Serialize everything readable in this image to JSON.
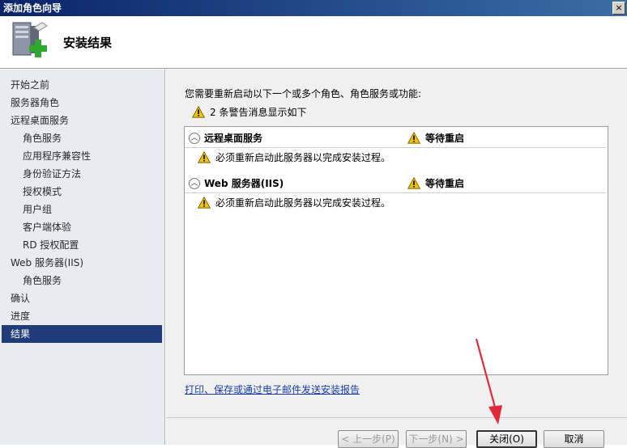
{
  "window": {
    "title": "添加角色向导",
    "close_glyph": "×"
  },
  "header": {
    "title": "安装结果"
  },
  "nav": {
    "items": [
      {
        "label": "开始之前",
        "sub": false,
        "active": false
      },
      {
        "label": "服务器角色",
        "sub": false,
        "active": false
      },
      {
        "label": "远程桌面服务",
        "sub": false,
        "active": false
      },
      {
        "label": "角色服务",
        "sub": true,
        "active": false
      },
      {
        "label": "应用程序兼容性",
        "sub": true,
        "active": false
      },
      {
        "label": "身份验证方法",
        "sub": true,
        "active": false
      },
      {
        "label": "授权模式",
        "sub": true,
        "active": false
      },
      {
        "label": "用户组",
        "sub": true,
        "active": false
      },
      {
        "label": "客户端体验",
        "sub": true,
        "active": false
      },
      {
        "label": "RD 授权配置",
        "sub": true,
        "active": false
      },
      {
        "label": "Web 服务器(IIS)",
        "sub": false,
        "active": false
      },
      {
        "label": "角色服务",
        "sub": true,
        "active": false
      },
      {
        "label": "确认",
        "sub": false,
        "active": false
      },
      {
        "label": "进度",
        "sub": false,
        "active": false
      },
      {
        "label": "结果",
        "sub": false,
        "active": true
      }
    ]
  },
  "main": {
    "intro": "您需要重新启动以下一个或多个角色、角色服务或功能:",
    "warning_summary": "2 条警告消息显示如下",
    "results": [
      {
        "name": "远程桌面服务",
        "status": "等待重启",
        "message": "必须重新启动此服务器以完成安装过程。"
      },
      {
        "name": "Web 服务器(IIS)",
        "status": "等待重启",
        "message": "必须重新启动此服务器以完成安装过程。"
      }
    ],
    "report_link": "打印、保存或通过电子邮件发送安装报告"
  },
  "buttons": {
    "back": "< 上一步(P)",
    "next": "下一步(N) >",
    "close": "关闭(O)",
    "cancel": "取消"
  },
  "colors": {
    "nav_active_bg": "#1f3c78",
    "link": "#1a3da8",
    "annotation_arrow": "#e0283a",
    "warning": "#f2c200"
  },
  "icons": {
    "header": "server-add-icon",
    "warning": "warning-icon",
    "collapse": "chevron-up-icon"
  }
}
